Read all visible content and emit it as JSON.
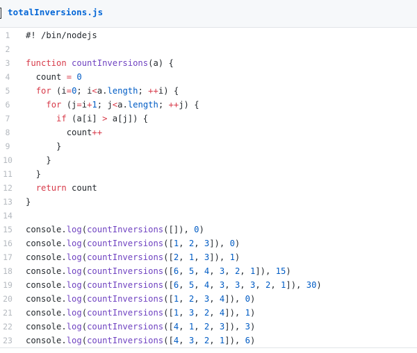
{
  "file": {
    "name": "totalInversions.js"
  },
  "colors": {
    "keyword": "#d73a49",
    "function": "#6f42c1",
    "number": "#005cc5",
    "text": "#24292e",
    "line_number": "#b4b9bf",
    "link": "#0366d6"
  },
  "lines": [
    {
      "n": "1",
      "tokens": [
        [
          "t",
          "#! /bin/nodejs"
        ]
      ]
    },
    {
      "n": "2",
      "tokens": []
    },
    {
      "n": "3",
      "tokens": [
        [
          "kw",
          "function"
        ],
        [
          "t",
          " "
        ],
        [
          "fn",
          "countInversions"
        ],
        [
          "t",
          "(a) {"
        ]
      ]
    },
    {
      "n": "4",
      "tokens": [
        [
          "t",
          "  count "
        ],
        [
          "op",
          "="
        ],
        [
          "t",
          " "
        ],
        [
          "num",
          "0"
        ]
      ]
    },
    {
      "n": "5",
      "tokens": [
        [
          "t",
          "  "
        ],
        [
          "kw",
          "for"
        ],
        [
          "t",
          " (i"
        ],
        [
          "op",
          "="
        ],
        [
          "num",
          "0"
        ],
        [
          "t",
          "; i"
        ],
        [
          "op",
          "<"
        ],
        [
          "t",
          "a."
        ],
        [
          "prop",
          "length"
        ],
        [
          "t",
          "; "
        ],
        [
          "op",
          "++"
        ],
        [
          "t",
          "i) {"
        ]
      ]
    },
    {
      "n": "6",
      "tokens": [
        [
          "t",
          "    "
        ],
        [
          "kw",
          "for"
        ],
        [
          "t",
          " (j"
        ],
        [
          "op",
          "="
        ],
        [
          "t",
          "i"
        ],
        [
          "op",
          "+"
        ],
        [
          "num",
          "1"
        ],
        [
          "t",
          "; j"
        ],
        [
          "op",
          "<"
        ],
        [
          "t",
          "a."
        ],
        [
          "prop",
          "length"
        ],
        [
          "t",
          "; "
        ],
        [
          "op",
          "++"
        ],
        [
          "t",
          "j) {"
        ]
      ]
    },
    {
      "n": "7",
      "tokens": [
        [
          "t",
          "      "
        ],
        [
          "kw",
          "if"
        ],
        [
          "t",
          " (a[i] "
        ],
        [
          "op",
          ">"
        ],
        [
          "t",
          " a[j]) {"
        ]
      ]
    },
    {
      "n": "8",
      "tokens": [
        [
          "t",
          "        count"
        ],
        [
          "op",
          "++"
        ]
      ]
    },
    {
      "n": "9",
      "tokens": [
        [
          "t",
          "      }"
        ]
      ]
    },
    {
      "n": "10",
      "tokens": [
        [
          "t",
          "    }"
        ]
      ]
    },
    {
      "n": "11",
      "tokens": [
        [
          "t",
          "  }"
        ]
      ]
    },
    {
      "n": "12",
      "tokens": [
        [
          "t",
          "  "
        ],
        [
          "kw",
          "return"
        ],
        [
          "t",
          " count"
        ]
      ]
    },
    {
      "n": "13",
      "tokens": [
        [
          "t",
          "}"
        ]
      ]
    },
    {
      "n": "14",
      "tokens": []
    },
    {
      "n": "15",
      "tokens": [
        [
          "t",
          "console."
        ],
        [
          "fn",
          "log"
        ],
        [
          "t",
          "("
        ],
        [
          "fn",
          "countInversions"
        ],
        [
          "t",
          "([]), "
        ],
        [
          "num",
          "0"
        ],
        [
          "t",
          ")"
        ]
      ]
    },
    {
      "n": "16",
      "tokens": [
        [
          "t",
          "console."
        ],
        [
          "fn",
          "log"
        ],
        [
          "t",
          "("
        ],
        [
          "fn",
          "countInversions"
        ],
        [
          "t",
          "(["
        ],
        [
          "num",
          "1"
        ],
        [
          "t",
          ", "
        ],
        [
          "num",
          "2"
        ],
        [
          "t",
          ", "
        ],
        [
          "num",
          "3"
        ],
        [
          "t",
          "]), "
        ],
        [
          "num",
          "0"
        ],
        [
          "t",
          ")"
        ]
      ]
    },
    {
      "n": "17",
      "tokens": [
        [
          "t",
          "console."
        ],
        [
          "fn",
          "log"
        ],
        [
          "t",
          "("
        ],
        [
          "fn",
          "countInversions"
        ],
        [
          "t",
          "(["
        ],
        [
          "num",
          "2"
        ],
        [
          "t",
          ", "
        ],
        [
          "num",
          "1"
        ],
        [
          "t",
          ", "
        ],
        [
          "num",
          "3"
        ],
        [
          "t",
          "]), "
        ],
        [
          "num",
          "1"
        ],
        [
          "t",
          ")"
        ]
      ]
    },
    {
      "n": "18",
      "tokens": [
        [
          "t",
          "console."
        ],
        [
          "fn",
          "log"
        ],
        [
          "t",
          "("
        ],
        [
          "fn",
          "countInversions"
        ],
        [
          "t",
          "(["
        ],
        [
          "num",
          "6"
        ],
        [
          "t",
          ", "
        ],
        [
          "num",
          "5"
        ],
        [
          "t",
          ", "
        ],
        [
          "num",
          "4"
        ],
        [
          "t",
          ", "
        ],
        [
          "num",
          "3"
        ],
        [
          "t",
          ", "
        ],
        [
          "num",
          "2"
        ],
        [
          "t",
          ", "
        ],
        [
          "num",
          "1"
        ],
        [
          "t",
          "]), "
        ],
        [
          "num",
          "15"
        ],
        [
          "t",
          ")"
        ]
      ]
    },
    {
      "n": "19",
      "tokens": [
        [
          "t",
          "console."
        ],
        [
          "fn",
          "log"
        ],
        [
          "t",
          "("
        ],
        [
          "fn",
          "countInversions"
        ],
        [
          "t",
          "(["
        ],
        [
          "num",
          "6"
        ],
        [
          "t",
          ", "
        ],
        [
          "num",
          "5"
        ],
        [
          "t",
          ", "
        ],
        [
          "num",
          "4"
        ],
        [
          "t",
          ", "
        ],
        [
          "num",
          "3"
        ],
        [
          "t",
          ", "
        ],
        [
          "num",
          "3"
        ],
        [
          "t",
          ", "
        ],
        [
          "num",
          "3"
        ],
        [
          "t",
          ", "
        ],
        [
          "num",
          "2"
        ],
        [
          "t",
          ", "
        ],
        [
          "num",
          "1"
        ],
        [
          "t",
          "]), "
        ],
        [
          "num",
          "30"
        ],
        [
          "t",
          ")"
        ]
      ]
    },
    {
      "n": "20",
      "tokens": [
        [
          "t",
          "console."
        ],
        [
          "fn",
          "log"
        ],
        [
          "t",
          "("
        ],
        [
          "fn",
          "countInversions"
        ],
        [
          "t",
          "(["
        ],
        [
          "num",
          "1"
        ],
        [
          "t",
          ", "
        ],
        [
          "num",
          "2"
        ],
        [
          "t",
          ", "
        ],
        [
          "num",
          "3"
        ],
        [
          "t",
          ", "
        ],
        [
          "num",
          "4"
        ],
        [
          "t",
          "]), "
        ],
        [
          "num",
          "0"
        ],
        [
          "t",
          ")"
        ]
      ]
    },
    {
      "n": "21",
      "tokens": [
        [
          "t",
          "console."
        ],
        [
          "fn",
          "log"
        ],
        [
          "t",
          "("
        ],
        [
          "fn",
          "countInversions"
        ],
        [
          "t",
          "(["
        ],
        [
          "num",
          "1"
        ],
        [
          "t",
          ", "
        ],
        [
          "num",
          "3"
        ],
        [
          "t",
          ", "
        ],
        [
          "num",
          "2"
        ],
        [
          "t",
          ", "
        ],
        [
          "num",
          "4"
        ],
        [
          "t",
          "]), "
        ],
        [
          "num",
          "1"
        ],
        [
          "t",
          ")"
        ]
      ]
    },
    {
      "n": "22",
      "tokens": [
        [
          "t",
          "console."
        ],
        [
          "fn",
          "log"
        ],
        [
          "t",
          "("
        ],
        [
          "fn",
          "countInversions"
        ],
        [
          "t",
          "(["
        ],
        [
          "num",
          "4"
        ],
        [
          "t",
          ", "
        ],
        [
          "num",
          "1"
        ],
        [
          "t",
          ", "
        ],
        [
          "num",
          "2"
        ],
        [
          "t",
          ", "
        ],
        [
          "num",
          "3"
        ],
        [
          "t",
          "]), "
        ],
        [
          "num",
          "3"
        ],
        [
          "t",
          ")"
        ]
      ]
    },
    {
      "n": "23",
      "tokens": [
        [
          "t",
          "console."
        ],
        [
          "fn",
          "log"
        ],
        [
          "t",
          "("
        ],
        [
          "fn",
          "countInversions"
        ],
        [
          "t",
          "(["
        ],
        [
          "num",
          "4"
        ],
        [
          "t",
          ", "
        ],
        [
          "num",
          "3"
        ],
        [
          "t",
          ", "
        ],
        [
          "num",
          "2"
        ],
        [
          "t",
          ", "
        ],
        [
          "num",
          "1"
        ],
        [
          "t",
          "]), "
        ],
        [
          "num",
          "6"
        ],
        [
          "t",
          ")"
        ]
      ]
    }
  ]
}
